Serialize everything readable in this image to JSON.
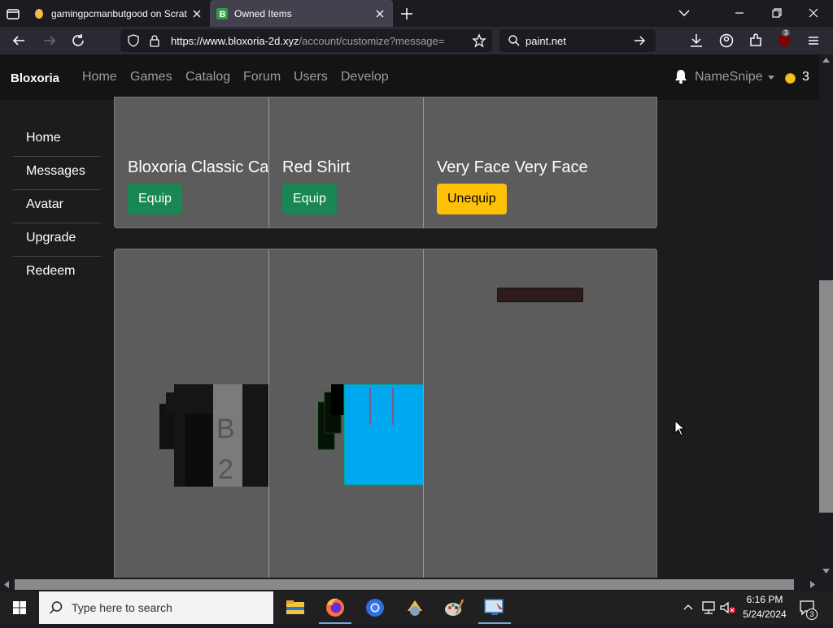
{
  "browser": {
    "tabs": [
      {
        "title": "gamingpcmanbutgood on Scrat",
        "favicon": "scratch-cat-icon",
        "active": false
      },
      {
        "title": "Owned Items",
        "favicon": "bloxoria-b-icon",
        "active": true
      }
    ],
    "url_host": "https://www.bloxoria-2d.xyz",
    "url_path": "/account/customize?message=",
    "search_query": "paint.net",
    "extension_badge": "3"
  },
  "site": {
    "brand": "Bloxoria",
    "nav_links": [
      "Home",
      "Games",
      "Catalog",
      "Forum",
      "Users",
      "Develop"
    ],
    "username": "NameSnipe",
    "coins": "3"
  },
  "sidebar": {
    "items": [
      "Home",
      "Messages",
      "Avatar",
      "Upgrade",
      "Redeem"
    ]
  },
  "items_row1": [
    {
      "title": "Bloxoria Classic Ca",
      "button": "Equip",
      "state": "equip"
    },
    {
      "title": "Red Shirt",
      "button": "Equip",
      "state": "equip"
    },
    {
      "title": "Very Face Very Face",
      "button": "Unequip",
      "state": "unequip"
    }
  ],
  "items_row2": [
    {
      "preview": "black-jacket-b2-shirt"
    },
    {
      "preview": "blue-shirt-with-black-sleeve"
    },
    {
      "preview": "dark-red-mouth-face"
    }
  ],
  "colors": {
    "equip": "#198754",
    "unequip": "#ffc107",
    "card_bg": "#5c5c5c"
  },
  "taskbar": {
    "search_placeholder": "Type here to search",
    "time": "6:16 PM",
    "date": "5/24/2024",
    "notification_count": "3"
  }
}
